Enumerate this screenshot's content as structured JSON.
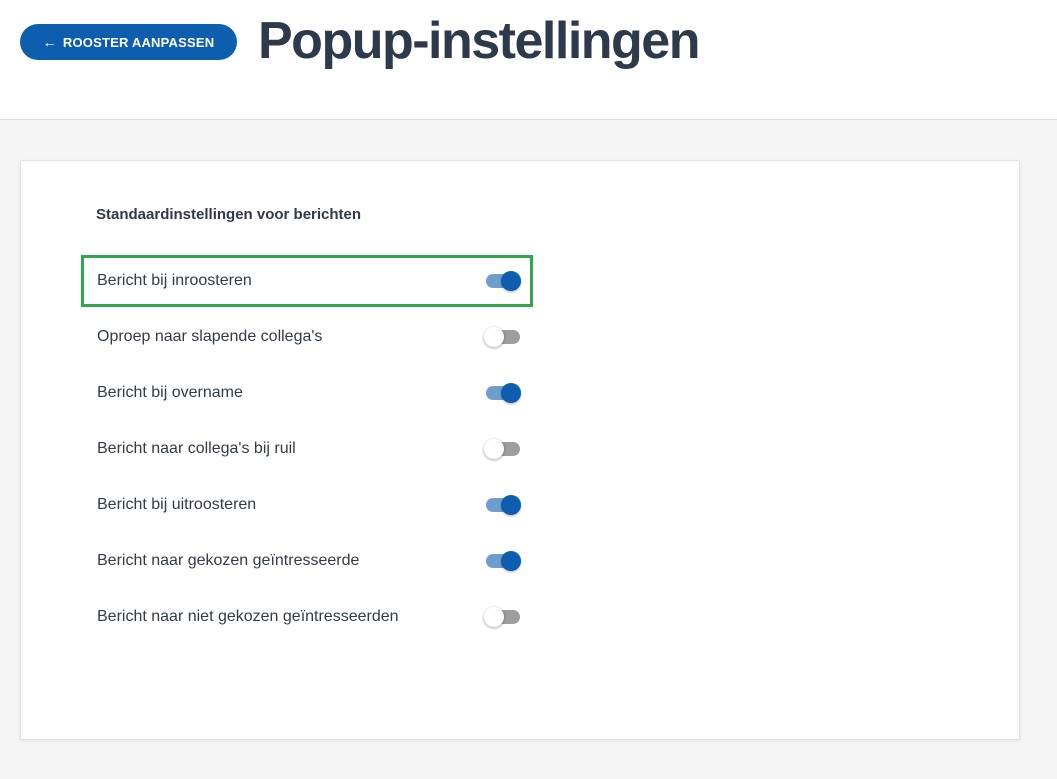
{
  "header": {
    "back_button_label": "ROOSTER AANPASSEN",
    "back_icon": "arrow-left-icon",
    "title": "Popup-instellingen"
  },
  "section": {
    "title": "Standaardinstellingen voor berichten"
  },
  "colors": {
    "accent": "#0d5eaf",
    "highlight": "#2ea84a"
  },
  "settings": [
    {
      "label": "Bericht bij inroosteren",
      "enabled": true,
      "highlighted": true
    },
    {
      "label": "Oproep naar slapende collega's",
      "enabled": false
    },
    {
      "label": "Bericht bij overname",
      "enabled": true
    },
    {
      "label": "Bericht naar collega's bij ruil",
      "enabled": false
    },
    {
      "label": "Bericht bij uitroosteren",
      "enabled": true
    },
    {
      "label": "Bericht naar gekozen geïntresseerde",
      "enabled": true
    },
    {
      "label": "Bericht naar niet gekozen geïntresseerden",
      "enabled": false
    }
  ]
}
